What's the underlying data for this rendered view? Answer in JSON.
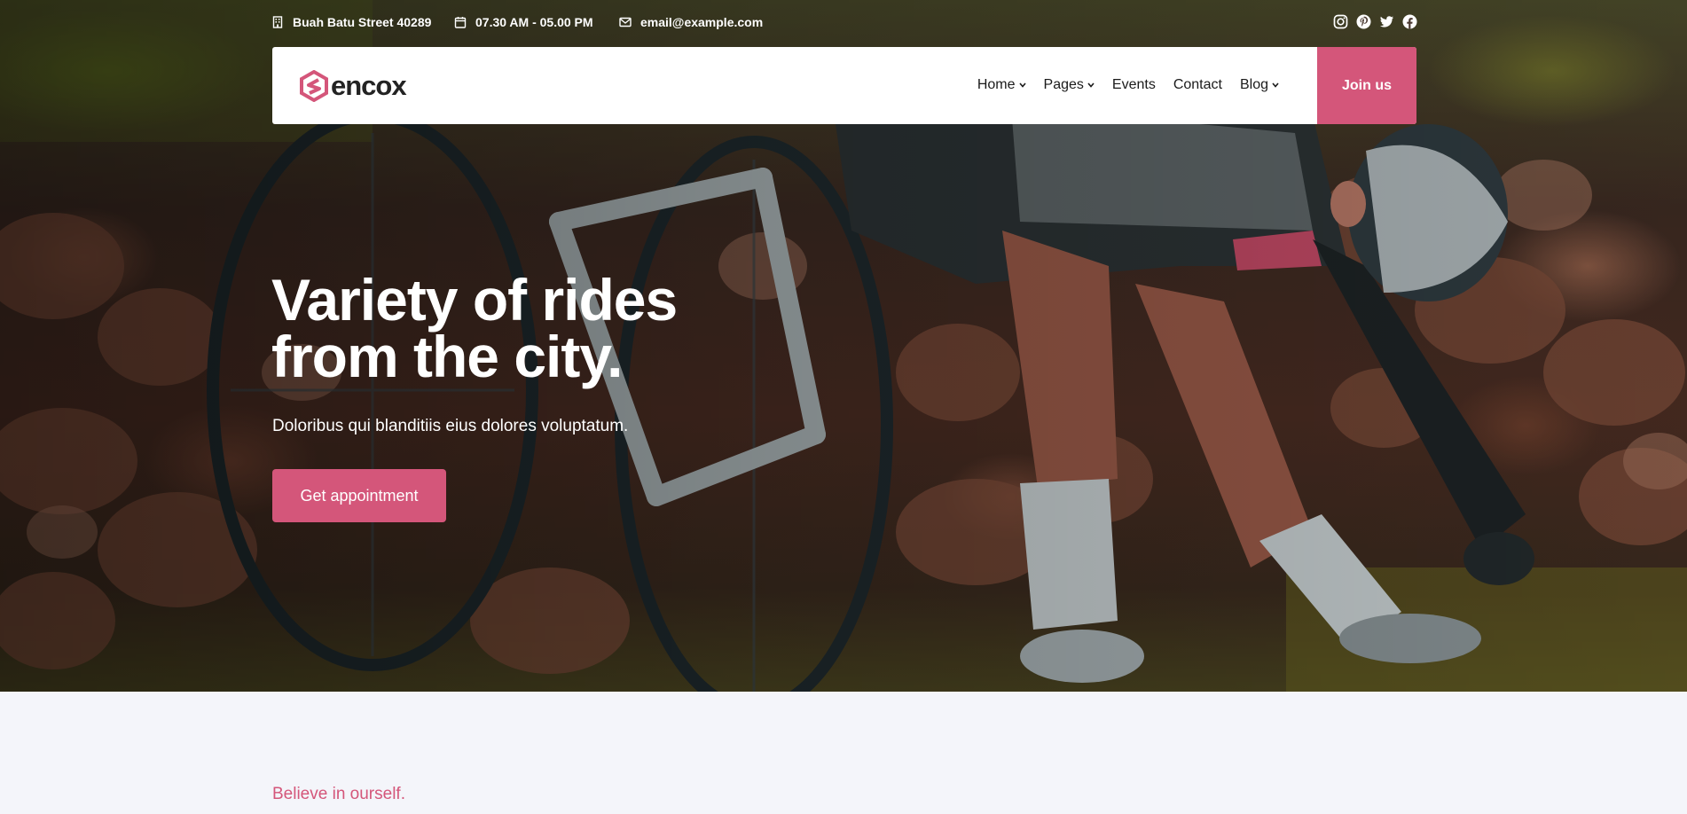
{
  "topbar": {
    "address": "Buah Batu Street 40289",
    "hours": "07.30 AM - 05.00 PM",
    "email": "email@example.com",
    "address_icon": "building-icon",
    "hours_icon": "calendar-icon",
    "email_icon": "envelope-icon",
    "social": [
      "instagram-icon",
      "pinterest-icon",
      "twitter-icon",
      "facebook-icon"
    ]
  },
  "nav": {
    "logo_text": "encox",
    "items": [
      {
        "label": "Home",
        "dropdown": true
      },
      {
        "label": "Pages",
        "dropdown": true
      },
      {
        "label": "Events",
        "dropdown": false
      },
      {
        "label": "Contact",
        "dropdown": false
      },
      {
        "label": "Blog",
        "dropdown": true
      }
    ],
    "cta": "Join us"
  },
  "hero": {
    "title_line1": "Variety of rides",
    "title_line2": "from the city.",
    "subtitle": "Doloribus qui blanditiis eius dolores voluptatum.",
    "button": "Get appointment"
  },
  "section": {
    "tagline": "Believe in ourself."
  },
  "colors": {
    "accent": "#d4567a",
    "nav_bg": "#ffffff",
    "page_bg": "#f4f5fa"
  }
}
